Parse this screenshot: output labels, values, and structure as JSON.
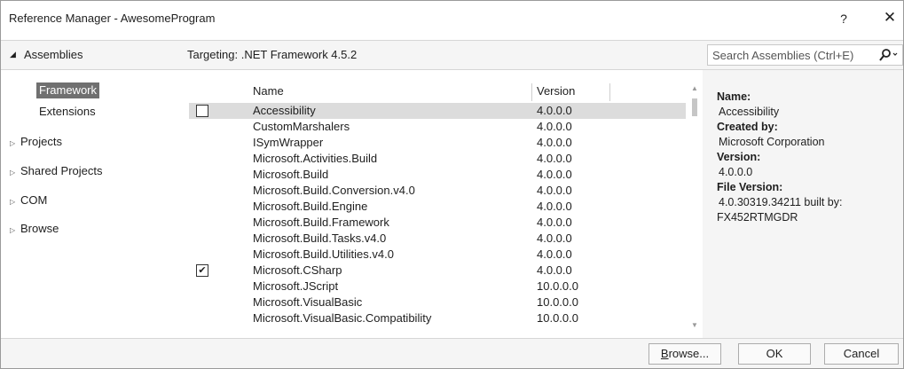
{
  "window": {
    "title": "Reference Manager - AwesomeProgram",
    "help_label": "?",
    "close_label": "✕"
  },
  "nav": {
    "header": "Assemblies",
    "sub_items": [
      {
        "label": "Framework"
      },
      {
        "label": "Extensions"
      }
    ],
    "items": [
      {
        "label": "Projects"
      },
      {
        "label": "Shared Projects"
      },
      {
        "label": "COM"
      },
      {
        "label": "Browse"
      }
    ]
  },
  "main": {
    "targeting": "Targeting: .NET Framework 4.5.2",
    "columns": {
      "name": "Name",
      "version": "Version"
    },
    "rows": [
      {
        "name": "Accessibility",
        "version": "4.0.0.0",
        "checked": false,
        "selected": true
      },
      {
        "name": "CustomMarshalers",
        "version": "4.0.0.0",
        "checked": false,
        "selected": false
      },
      {
        "name": "ISymWrapper",
        "version": "4.0.0.0",
        "checked": false,
        "selected": false
      },
      {
        "name": "Microsoft.Activities.Build",
        "version": "4.0.0.0",
        "checked": false,
        "selected": false
      },
      {
        "name": "Microsoft.Build",
        "version": "4.0.0.0",
        "checked": false,
        "selected": false
      },
      {
        "name": "Microsoft.Build.Conversion.v4.0",
        "version": "4.0.0.0",
        "checked": false,
        "selected": false
      },
      {
        "name": "Microsoft.Build.Engine",
        "version": "4.0.0.0",
        "checked": false,
        "selected": false
      },
      {
        "name": "Microsoft.Build.Framework",
        "version": "4.0.0.0",
        "checked": false,
        "selected": false
      },
      {
        "name": "Microsoft.Build.Tasks.v4.0",
        "version": "4.0.0.0",
        "checked": false,
        "selected": false
      },
      {
        "name": "Microsoft.Build.Utilities.v4.0",
        "version": "4.0.0.0",
        "checked": false,
        "selected": false
      },
      {
        "name": "Microsoft.CSharp",
        "version": "4.0.0.0",
        "checked": true,
        "selected": false
      },
      {
        "name": "Microsoft.JScript",
        "version": "10.0.0.0",
        "checked": false,
        "selected": false
      },
      {
        "name": "Microsoft.VisualBasic",
        "version": "10.0.0.0",
        "checked": false,
        "selected": false
      },
      {
        "name": "Microsoft.VisualBasic.Compatibility",
        "version": "10.0.0.0",
        "checked": false,
        "selected": false
      }
    ]
  },
  "search": {
    "placeholder": "Search Assemblies (Ctrl+E)",
    "icon": "search-icon"
  },
  "details": {
    "name_label": "Name:",
    "name_value": "Accessibility",
    "created_label": "Created by:",
    "created_value": "Microsoft Corporation",
    "version_label": "Version:",
    "version_value": "4.0.0.0",
    "file_version_label": "File Version:",
    "file_version_value_1": "4.0.30319.34211 built by:",
    "file_version_value_2": "FX452RTMGDR"
  },
  "footer": {
    "browse_label": "Browse...",
    "browse_access": "B",
    "browse_rest": "rowse...",
    "ok_label": "OK",
    "cancel_label": "Cancel"
  },
  "colors": {
    "selected_nav": "#707070",
    "selected_row": "#dcdcdc",
    "panel_bg": "#f5f5f5"
  }
}
